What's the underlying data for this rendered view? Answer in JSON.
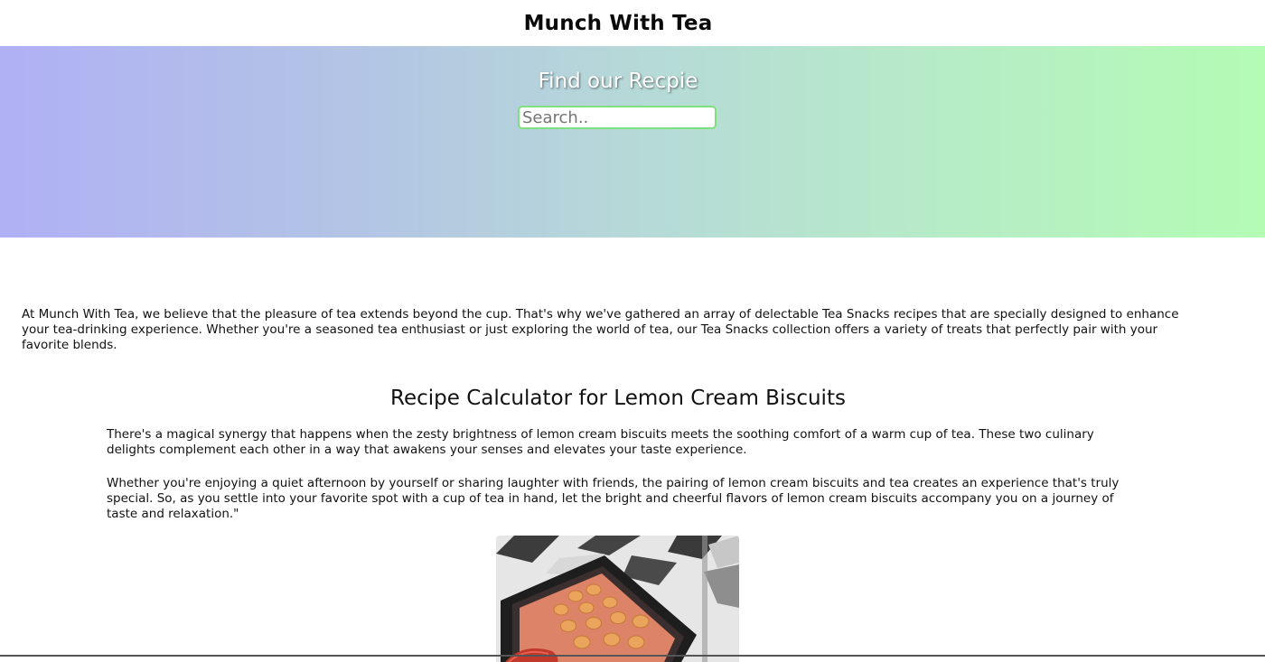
{
  "header": {
    "title": "Munch With Tea"
  },
  "hero": {
    "title": "Find our Recpie",
    "search": {
      "placeholder": "Search..",
      "value": ""
    }
  },
  "intro": {
    "text": "At Munch With Tea, we believe that the pleasure of tea extends beyond the cup. That's why we've gathered an array of delectable Tea Snacks recipes that are specially designed to enhance your tea-drinking experience. Whether you're a seasoned tea enthusiast or just exploring the world of tea, our Tea Snacks collection offers a variety of treats that perfectly pair with your favorite blends."
  },
  "recipe": {
    "title": "Recipe Calculator for Lemon Cream Biscuits",
    "paragraphs": [
      "There's a magical synergy that happens when the zesty brightness of lemon cream biscuits meets the soothing comfort of a warm cup of tea. These two culinary delights complement each other in a way that awakens your senses and elevates your taste experience.",
      "Whether you're enjoying a quiet afternoon by yourself or sharing laughter with friends, the pairing of lemon cream biscuits and tea creates an experience that's truly special. So, as you settle into your favorite spot with a cup of tea in hand, let the bright and cheerful flavors of lemon cream biscuits accompany you on a journey of taste and relaxation.\""
    ]
  },
  "colors": {
    "hero_gradient_start": "#b0b0f5",
    "hero_gradient_end": "#b4fcb4",
    "search_border": "#7fe07f"
  }
}
